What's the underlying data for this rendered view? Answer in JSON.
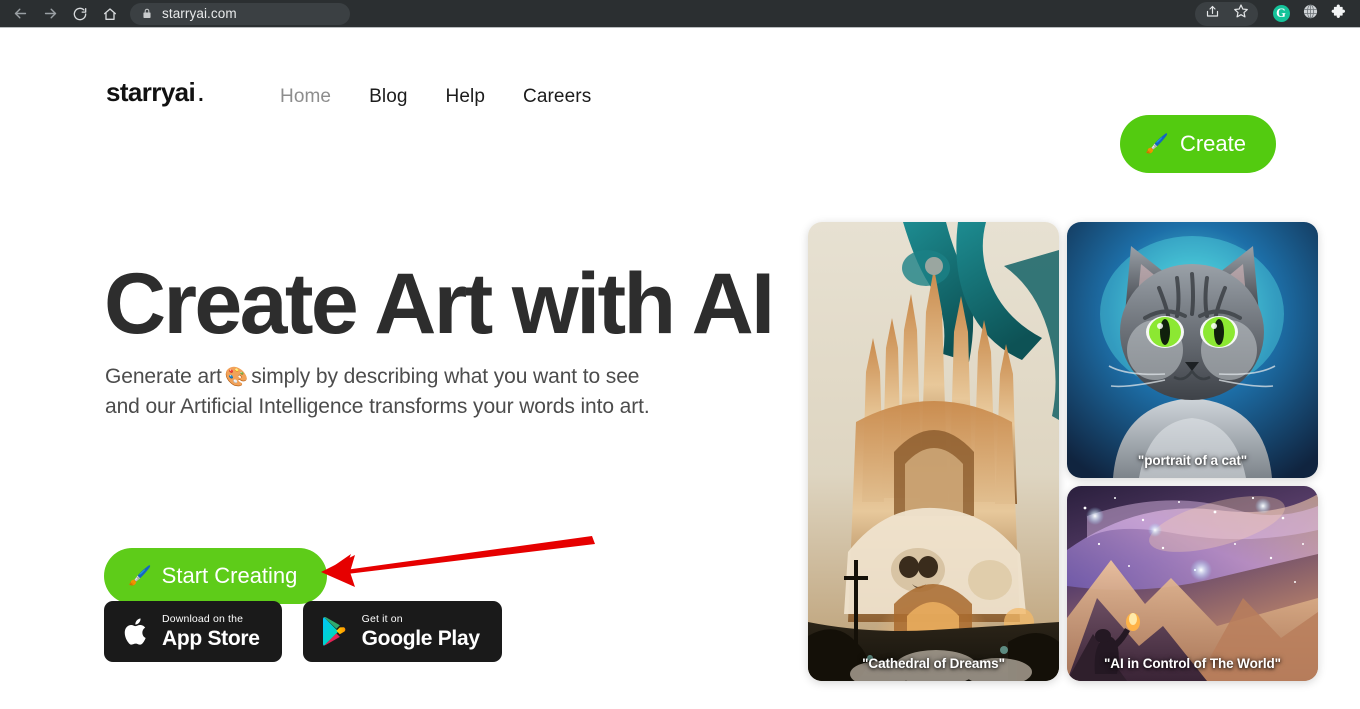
{
  "browser": {
    "back_icon": "back-arrow-icon",
    "forward_icon": "forward-arrow-icon",
    "reload_icon": "reload-icon",
    "home_icon": "home-icon",
    "lock_icon": "lock-icon",
    "url": "starryai.com",
    "right_icons": [
      {
        "name": "share-icon",
        "label": "Share"
      },
      {
        "name": "bookmark-star-icon",
        "label": "Bookmark"
      },
      {
        "name": "grammarly-icon",
        "label": "G"
      },
      {
        "name": "globe-icon",
        "label": "Translate"
      },
      {
        "name": "extensions-puzzle-icon",
        "label": "Extensions"
      }
    ]
  },
  "header": {
    "logo": "starryai",
    "logo_mark": ".",
    "nav": [
      {
        "label": "Home",
        "active": true
      },
      {
        "label": "Blog",
        "active": false
      },
      {
        "label": "Help",
        "active": false
      },
      {
        "label": "Careers",
        "active": false
      }
    ],
    "create_button": {
      "label": "Create",
      "icon": "paintbrush-emoji",
      "emoji": "🖌️",
      "color": "#53cb10"
    }
  },
  "hero": {
    "title": "Create Art with AI",
    "subtitle_line1_before": "Generate art",
    "subtitle_emoji": "🎨",
    "subtitle_line1_after": "simply by describing what you want to see",
    "subtitle_line2": "and our Artificial Intelligence transforms your words into art.",
    "start_button": {
      "label": "Start Creating",
      "icon": "paintbrush-emoji",
      "emoji": "🖌️",
      "color": "#5ecc19"
    },
    "stores": [
      {
        "icon": "apple-logo-icon",
        "top_label": "Download on the",
        "bottom_label": "App Store"
      },
      {
        "icon": "google-play-logo-icon",
        "top_label": "Get it on",
        "bottom_label": "Google Play"
      }
    ]
  },
  "annotation": {
    "arrow_color": "#e60000",
    "arrow_name": "red-annotation-arrow",
    "points_to": "Start Creating"
  },
  "gallery": [
    {
      "name": "art-card-cathedral",
      "caption": "\"Cathedral of Dreams\"",
      "palette": [
        "#e9e2d4",
        "#1b7a80",
        "#c8793c",
        "#f2e0c4",
        "#2a2118"
      ]
    },
    {
      "name": "art-card-cat",
      "caption": "\"portrait of a cat\"",
      "palette": [
        "#1e3a5f",
        "#3fd6e0",
        "#6b6f75",
        "#8ce832",
        "#cfd4d8"
      ]
    },
    {
      "name": "art-card-space",
      "caption": "\"AI in Control of The World\"",
      "palette": [
        "#3b2a4d",
        "#b38fd0",
        "#e8b98a",
        "#f3d6b0",
        "#7a5a78"
      ]
    }
  ]
}
